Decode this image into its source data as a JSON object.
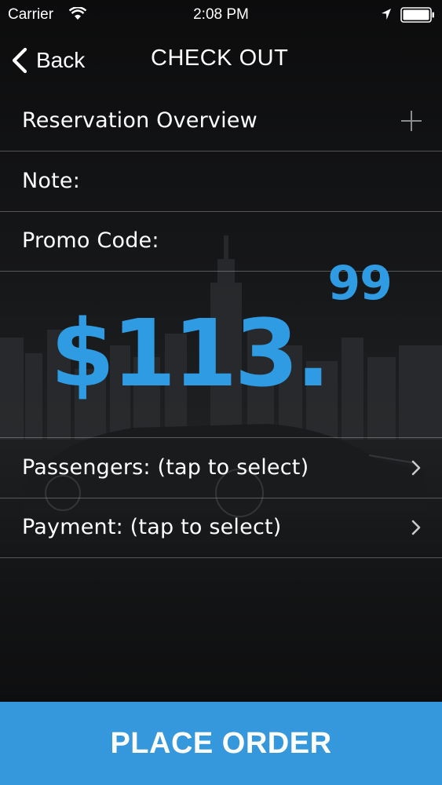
{
  "status_bar": {
    "carrier": "Carrier",
    "time": "2:08 PM",
    "icons": [
      "wifi-icon",
      "location-icon",
      "battery-icon"
    ]
  },
  "nav": {
    "back_label": "Back",
    "title": "CHECK OUT"
  },
  "rows": {
    "reservation_overview": "Reservation Overview",
    "note": "Note:",
    "promo_code": "Promo Code:",
    "passengers": "Passengers: (tap to select)",
    "payment": "Payment:  (tap to select)"
  },
  "price": {
    "dollars": "$113.",
    "cents": "99"
  },
  "place_order_label": "PLACE ORDER",
  "colors": {
    "accent": "#3598dc",
    "price": "#2f9be3",
    "background": "#0b0b0c"
  }
}
